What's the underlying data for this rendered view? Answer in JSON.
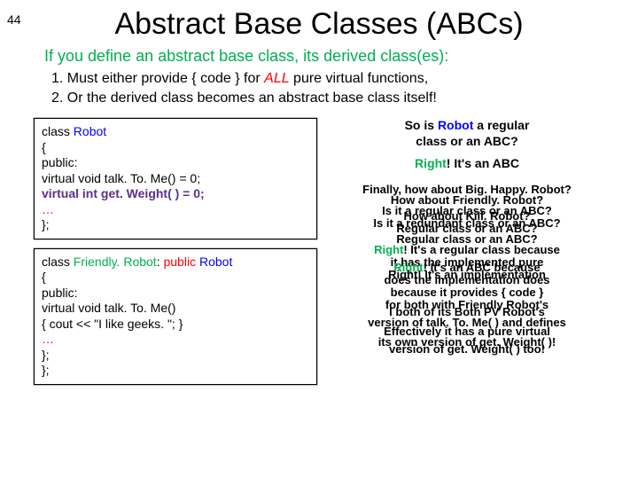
{
  "pageNumber": "44",
  "title": "Abstract Base Classes (ABCs)",
  "subtitle": "If you define an abstract base class, its derived class(es):",
  "list": {
    "item1_pre": "1.  Must either provide { code } for ",
    "item1_em": "ALL",
    "item1_post": " pure virtual functions,",
    "item2": "2.  Or the derived class becomes an abstract base class itself!"
  },
  "code1": {
    "l1a": "class ",
    "l1b": "Robot",
    "l2": "{",
    "l3": "public:",
    "l4": "   virtual void talk. To. Me() = 0;",
    "l5": "   virtual int get. Weight( ) = 0;",
    "l6": "…",
    "l7": "};"
  },
  "code2": {
    "l1a": "class ",
    "l1b": "Friendly. Robot",
    "l1c": ": ",
    "l1d": "public",
    "l1e": " ",
    "l1f": "Robot",
    "l2": "{",
    "l3": "public:",
    "l4": "   virtual void talk. To. Me()",
    "l5": "     { cout << \"I like geeks. \"; }",
    "l6": "…",
    "l7": "};",
    "l8": "};"
  },
  "qa": {
    "q1a": "So is ",
    "q1b": "Robot",
    "q1c": " a regular",
    "q1d": "class or an ABC?",
    "a1a": "Right",
    "a1b": "! It's an ABC"
  },
  "stack": {
    "s1": "Finally, how about Big. Happy. Robot?",
    "s2": "How about Friendly. Robot?",
    "s3": "Is it a regular class or an ABC?",
    "s4": "How about Kill. Robot?",
    "s5": "Is it a redundant class or an ABC?",
    "s6": "Regular class or an ABC?",
    "s7": "Regular class or an ABC?",
    "s8a": "Right",
    "s8b": "! It's a regular class because",
    "s9": "it has the implemented pure",
    "s10a": "Right",
    "s10b": "! It's an ABC because",
    "s11": "Right! It's an implementation",
    "s12": "does the implementation does",
    "s13": "because it provides { code }",
    "s14": "for both with Friendly Robot's",
    "s15": "I both of its Both PV Robot's",
    "s16": "version of talk. To. Me( ) and defines",
    "s17": "Effectively it has a pure virtual",
    "s18": "its own version of get. Weight( )!",
    "s19": "version of get. Weight( ) too!"
  }
}
